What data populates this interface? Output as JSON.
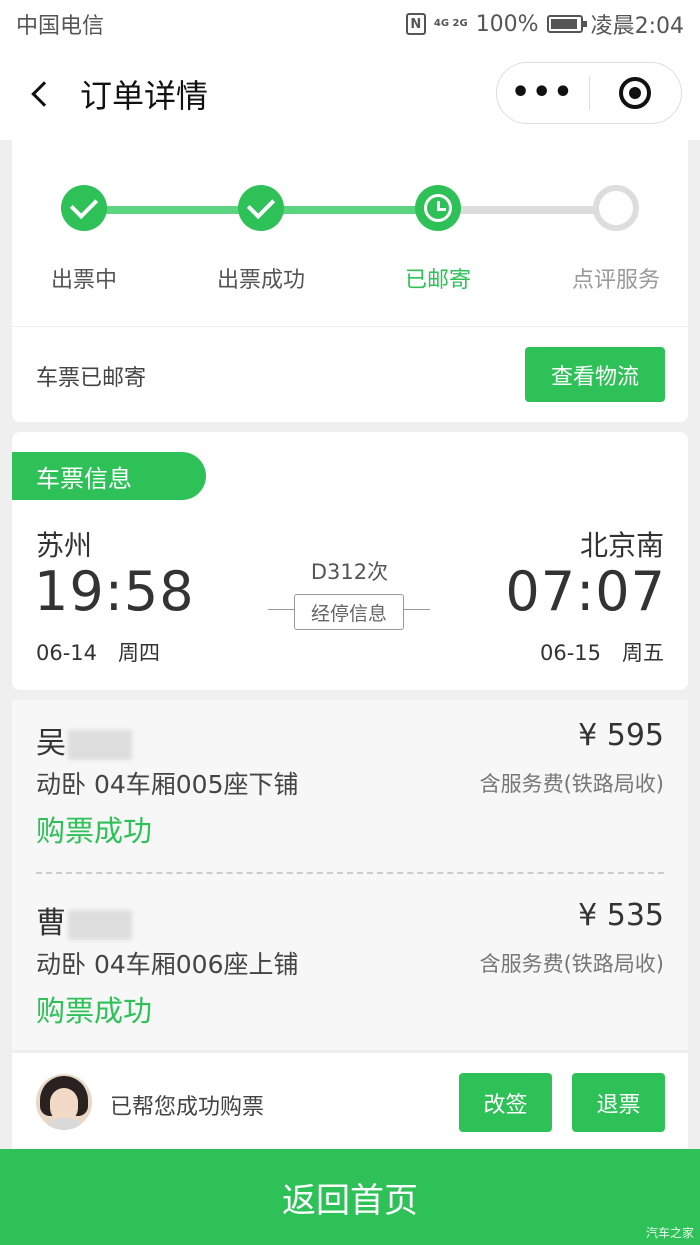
{
  "status_bar": {
    "carrier": "中国电信",
    "nfc": "N",
    "signal": "4G 2G",
    "battery": "100%",
    "time": "凌晨2:04"
  },
  "nav": {
    "title": "订单详情",
    "more_icon": "more-dots-icon",
    "close_icon": "target-icon"
  },
  "progress": {
    "steps": [
      {
        "label": "出票中",
        "state": "done"
      },
      {
        "label": "出票成功",
        "state": "done"
      },
      {
        "label": "已邮寄",
        "state": "active"
      },
      {
        "label": "点评服务",
        "state": "pending"
      }
    ],
    "status_text": "车票已邮寄",
    "logistics_button": "查看物流"
  },
  "ticket": {
    "tag": "车票信息",
    "from_city": "苏州",
    "from_time": "19:58",
    "from_date": "06-14　周四",
    "to_city": "北京南",
    "to_time": "07:07",
    "to_date": "06-15　周五",
    "train_no": "D312次",
    "stop_info": "经停信息"
  },
  "passengers": [
    {
      "name": "吴",
      "price": "¥ 595",
      "seat": "动卧 04车厢005座下铺",
      "fee": "含服务费(铁路局收)",
      "status": "购票成功"
    },
    {
      "name": "曹",
      "price": "¥ 535",
      "seat": "动卧 04车厢006座上铺",
      "fee": "含服务费(铁路局收)",
      "status": "购票成功"
    }
  ],
  "agent": {
    "text": "已帮您成功购票",
    "change_button": "改签",
    "refund_button": "退票"
  },
  "footer": {
    "home_button": "返回首页",
    "watermark": "汽车之家"
  },
  "colors": {
    "accent": "#2dc158",
    "track_done": "#5cd37f",
    "track_pending": "#dddddd"
  }
}
